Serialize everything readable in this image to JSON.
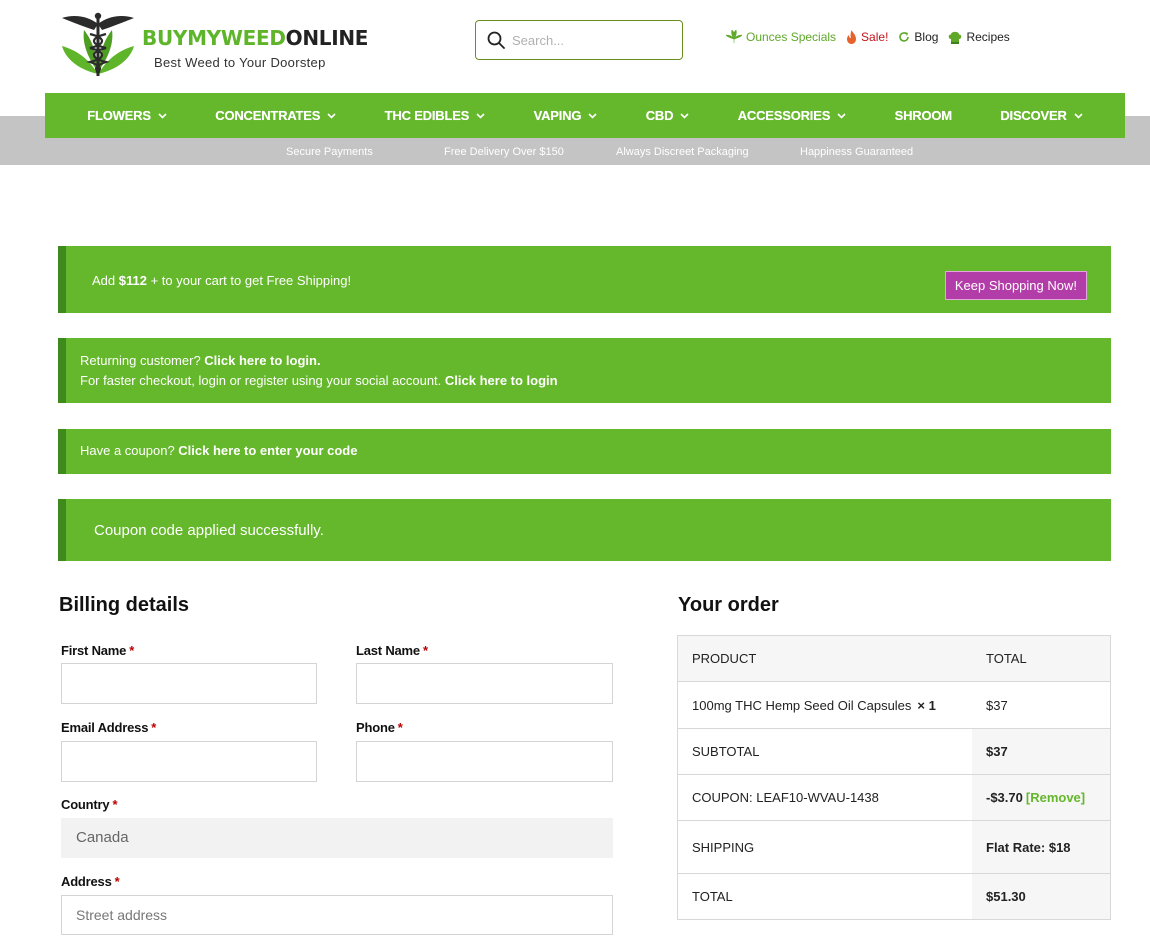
{
  "brand": {
    "name_part1": "BUYMYWEED",
    "name_part2": "ONLINE",
    "tagline": "Best Weed to Your Doorstep"
  },
  "search": {
    "placeholder": "Search..."
  },
  "toplinks": [
    {
      "label": "Ounces Specials",
      "icon": "leaf-icon"
    },
    {
      "label": "Sale!",
      "icon": "flame-icon"
    },
    {
      "label": "Blog",
      "icon": "refresh-icon"
    },
    {
      "label": "Recipes",
      "icon": "chef-hat-icon"
    }
  ],
  "nav": [
    {
      "label": "FLOWERS",
      "dropdown": true
    },
    {
      "label": "CONCENTRATES",
      "dropdown": true
    },
    {
      "label": "THC EDIBLES",
      "dropdown": true
    },
    {
      "label": "VAPING",
      "dropdown": true
    },
    {
      "label": "CBD",
      "dropdown": true
    },
    {
      "label": "ACCESSORIES",
      "dropdown": true
    },
    {
      "label": "SHROOM",
      "dropdown": false
    },
    {
      "label": "DISCOVER",
      "dropdown": true
    }
  ],
  "trust": [
    "Secure Payments",
    "Free Delivery Over $150",
    "Always Discreet Packaging",
    "Happiness Guaranteed"
  ],
  "notices": {
    "shipping_prefix": "Add ",
    "shipping_amount": "$112",
    "shipping_suffix": " + to your cart to get Free Shipping!",
    "keep_shopping": "Keep Shopping Now!",
    "returning_text": "Returning customer? ",
    "returning_link": "Click here to login.",
    "social_text": "For faster checkout, login or register using your social account. ",
    "social_link": "Click here to login",
    "coupon_text": "Have a coupon? ",
    "coupon_link": "Click here to enter your code",
    "coupon_success": "Coupon code applied successfully."
  },
  "billing": {
    "title": "Billing details",
    "first_name": "First Name",
    "last_name": "Last Name",
    "email": "Email Address",
    "phone": "Phone",
    "country": "Country",
    "country_value": "Canada",
    "address": "Address",
    "address_placeholder": "Street address",
    "required_mark": "*"
  },
  "order": {
    "title": "Your order",
    "col_product": "Product",
    "col_total": "Total",
    "item_name": "100mg THC Hemp Seed Oil Capsules",
    "item_qty": "× 1",
    "item_total": "$37",
    "subtotal_label": "SUBTOTAL",
    "subtotal_value": "$37",
    "coupon_label": "COUPON: LEAF10-WVAU-1438",
    "coupon_value": "-$3.70",
    "coupon_remove": "[Remove]",
    "shipping_label": "SHIPPING",
    "shipping_value": "Flat Rate: $18",
    "total_label": "TOTAL",
    "total_value": "$51.30"
  },
  "colors": {
    "brand_green": "#65b72b",
    "notice_border": "#3f8a1c",
    "button_magenta": "#b33da8",
    "required_red": "#bb0000",
    "sale_red": "#c0151c"
  }
}
